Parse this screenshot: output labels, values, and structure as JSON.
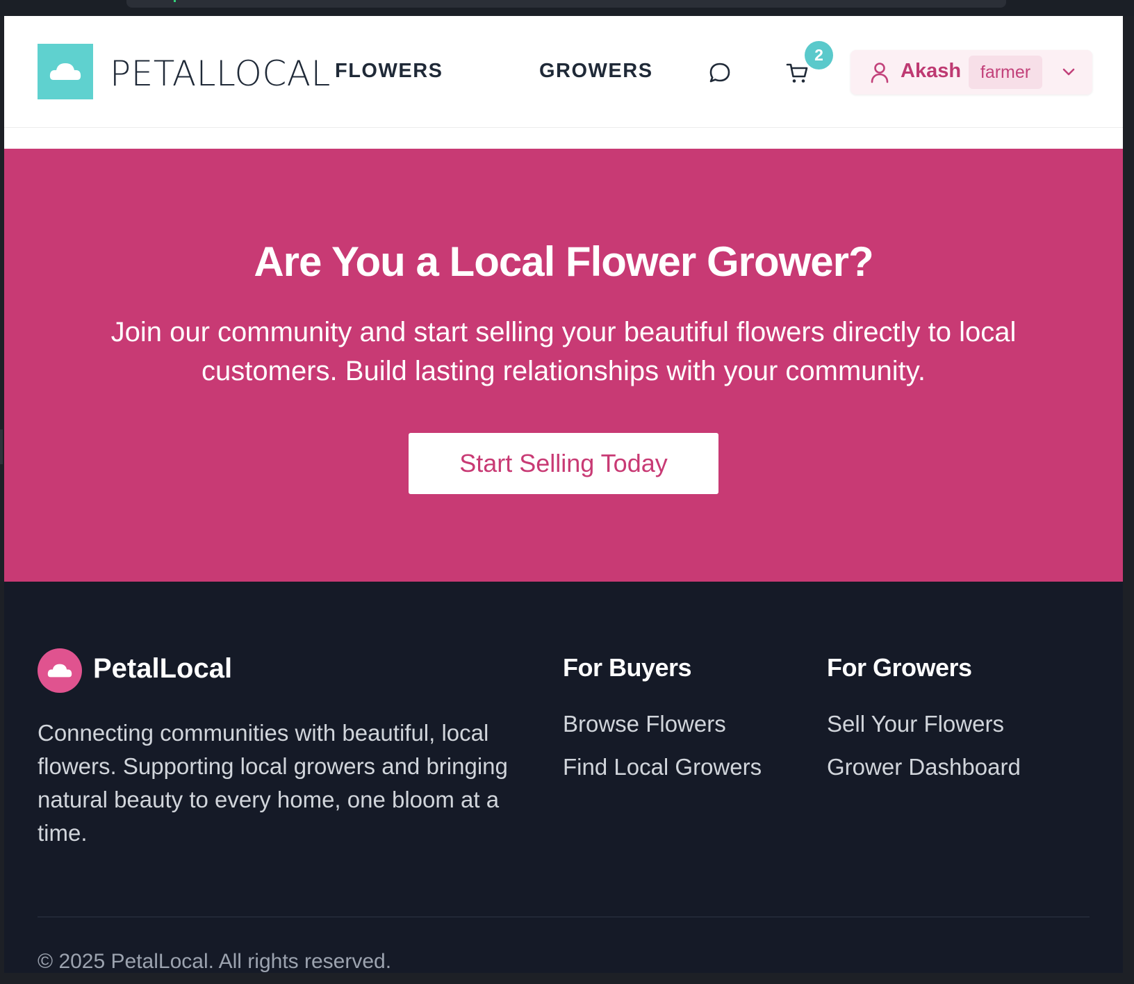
{
  "header": {
    "brand": "PETALLOCAL",
    "nav": [
      {
        "label": "FLOWERS"
      },
      {
        "label": "GROWERS"
      }
    ],
    "cart_count": "2",
    "user": {
      "name": "Akash",
      "role": "farmer"
    },
    "icons": [
      "logo-flower-icon",
      "chat-icon",
      "cart-icon",
      "user-icon",
      "chevron-down-icon"
    ]
  },
  "hero": {
    "title": "Are You a Local Flower Grower?",
    "subtitle": "Join our community and start selling your beautiful flowers directly to local customers. Build lasting relationships with your community.",
    "cta_label": "Start Selling Today"
  },
  "footer": {
    "brand": "PetalLocal",
    "description": "Connecting communities with beautiful, local flowers. Supporting local growers and bringing natural beauty to every home, one bloom at a time.",
    "columns": [
      {
        "title": "For Buyers",
        "links": [
          "Browse Flowers",
          "Find Local Growers"
        ]
      },
      {
        "title": "For Growers",
        "links": [
          "Sell Your Flowers",
          "Grower Dashboard"
        ]
      }
    ],
    "copyright": "© 2025 PetalLocal. All rights reserved."
  },
  "colors": {
    "accent_teal": "#5fd1cf",
    "hero_pink": "#c83a74",
    "footer_bg": "#151a27"
  }
}
